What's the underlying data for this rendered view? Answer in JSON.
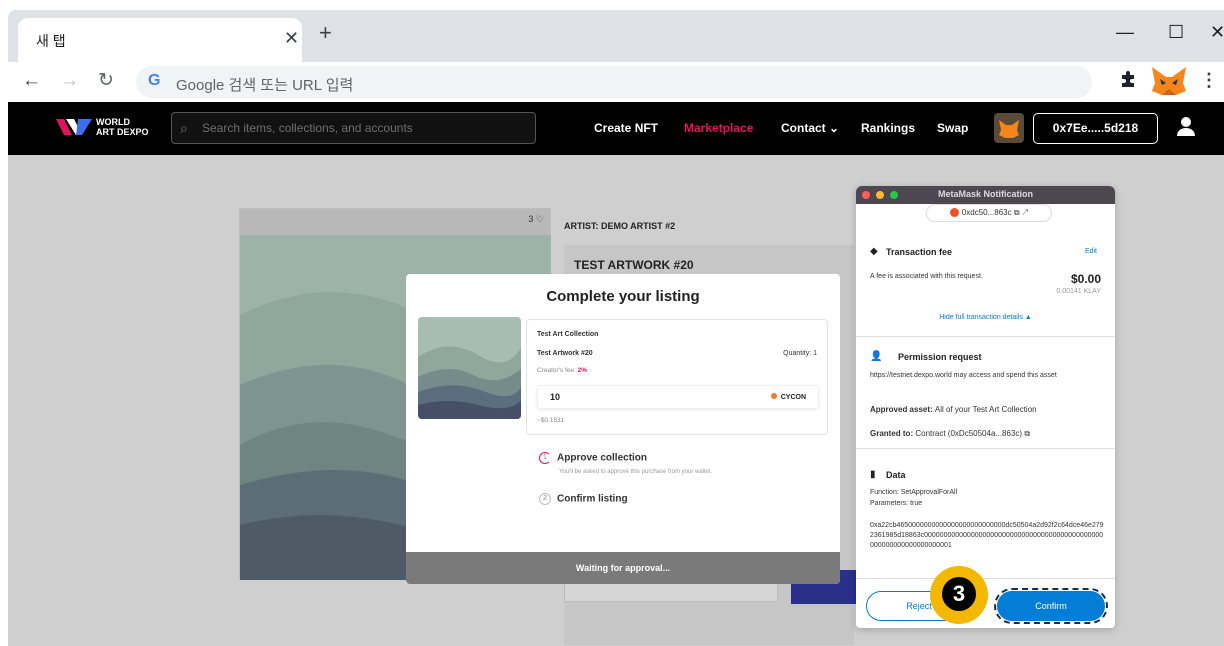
{
  "browser": {
    "tab_title": "새 탭",
    "tab_close": "✕",
    "new_tab": "+",
    "address_placeholder": "Google 검색 또는 URL 입력",
    "window_controls": [
      "—",
      "☐",
      "✕"
    ]
  },
  "site": {
    "logo_line1": "WORLD",
    "logo_line2": "ART DEXPO",
    "search_placeholder": "Search items, collections, and accounts",
    "nav": [
      {
        "label": "Create NFT"
      },
      {
        "label": "Marketplace"
      },
      {
        "label": "Contact ⌄"
      },
      {
        "label": "Rankings"
      },
      {
        "label": "Swap"
      }
    ],
    "wallet_address": "0x7Ee.....5d218",
    "accent_color": "#e0145c"
  },
  "artwork": {
    "likes": "3 ♡",
    "artist": "ARTIST: DEMO ARTIST #2",
    "title": "TEST ARTWORK #20"
  },
  "listing_modal": {
    "title": "Complete your listing",
    "collection": "Test Art Collection",
    "item": "Test Artwork #20",
    "quantity": "Quantity: 1",
    "creator_fee_label": "Creator's fee:",
    "creator_fee_value": "2%",
    "price": "10",
    "currency": "CYCON",
    "usd": "~$0.1531",
    "step1_num": "1",
    "step1_title": "Approve collection",
    "step1_sub": "You'll be asked to approve this purchase from your wallet.",
    "step2_num": "2",
    "step2_title": "Confirm listing",
    "waiting": "Waiting for approval..."
  },
  "metamask": {
    "title": "MetaMask Notification",
    "account": "0xdc50...863c",
    "fee_title": "Transaction fee",
    "edit": "Edit",
    "fee_desc": "A fee is associated with this request.",
    "fee_value": "$0.00",
    "fee_klay": "0.00141 KLAY",
    "hide_details": "Hide full transaction details ▲",
    "perm_title": "Permission request",
    "perm_desc": "https://testnet.dexpo.world may access and spend this asset",
    "approved_label": "Approved asset:",
    "approved_value": "All of your Test Art Collection",
    "granted_label": "Granted to:",
    "granted_value": "Contract (0xDc50504a...863c)",
    "data_title": "Data",
    "function": "Function: SetApprovalForAll",
    "parameters": "Parameters: true",
    "hex": "0xa22cb4650000000000000000000000000dc50504a2d92f2c64dce46e2792361985d18863c0000000000000000000000000000000000000000000000000000000000000000001",
    "reject": "Reject",
    "confirm": "Confirm"
  },
  "step_badge": "3"
}
